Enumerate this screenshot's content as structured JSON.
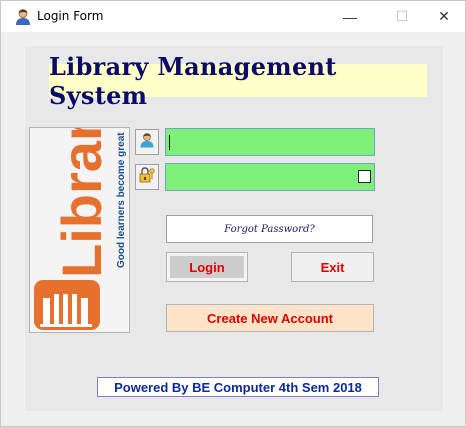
{
  "window": {
    "title": "Login Form",
    "minimize_glyph": "—",
    "maximize_glyph": "☐",
    "close_glyph": "✕"
  },
  "header": {
    "title": "Library Management System"
  },
  "logo": {
    "word": "Library",
    "tagline": "Good learners become great"
  },
  "icons": {
    "title": "user-icon",
    "username": "user-icon",
    "password": "lock-icon"
  },
  "form": {
    "username_value": "",
    "password_value": "",
    "forgot_label": "Forgot Password?"
  },
  "buttons": {
    "login": "Login",
    "exit": "Exit",
    "create": "Create New Account"
  },
  "footer": {
    "text": "Powered By BE Computer 4th Sem 2018"
  },
  "colors": {
    "field_bg": "#7ef07a",
    "header_bg": "#ffffc8",
    "accent_red": "#e00000",
    "logo_orange": "#e6702e"
  }
}
